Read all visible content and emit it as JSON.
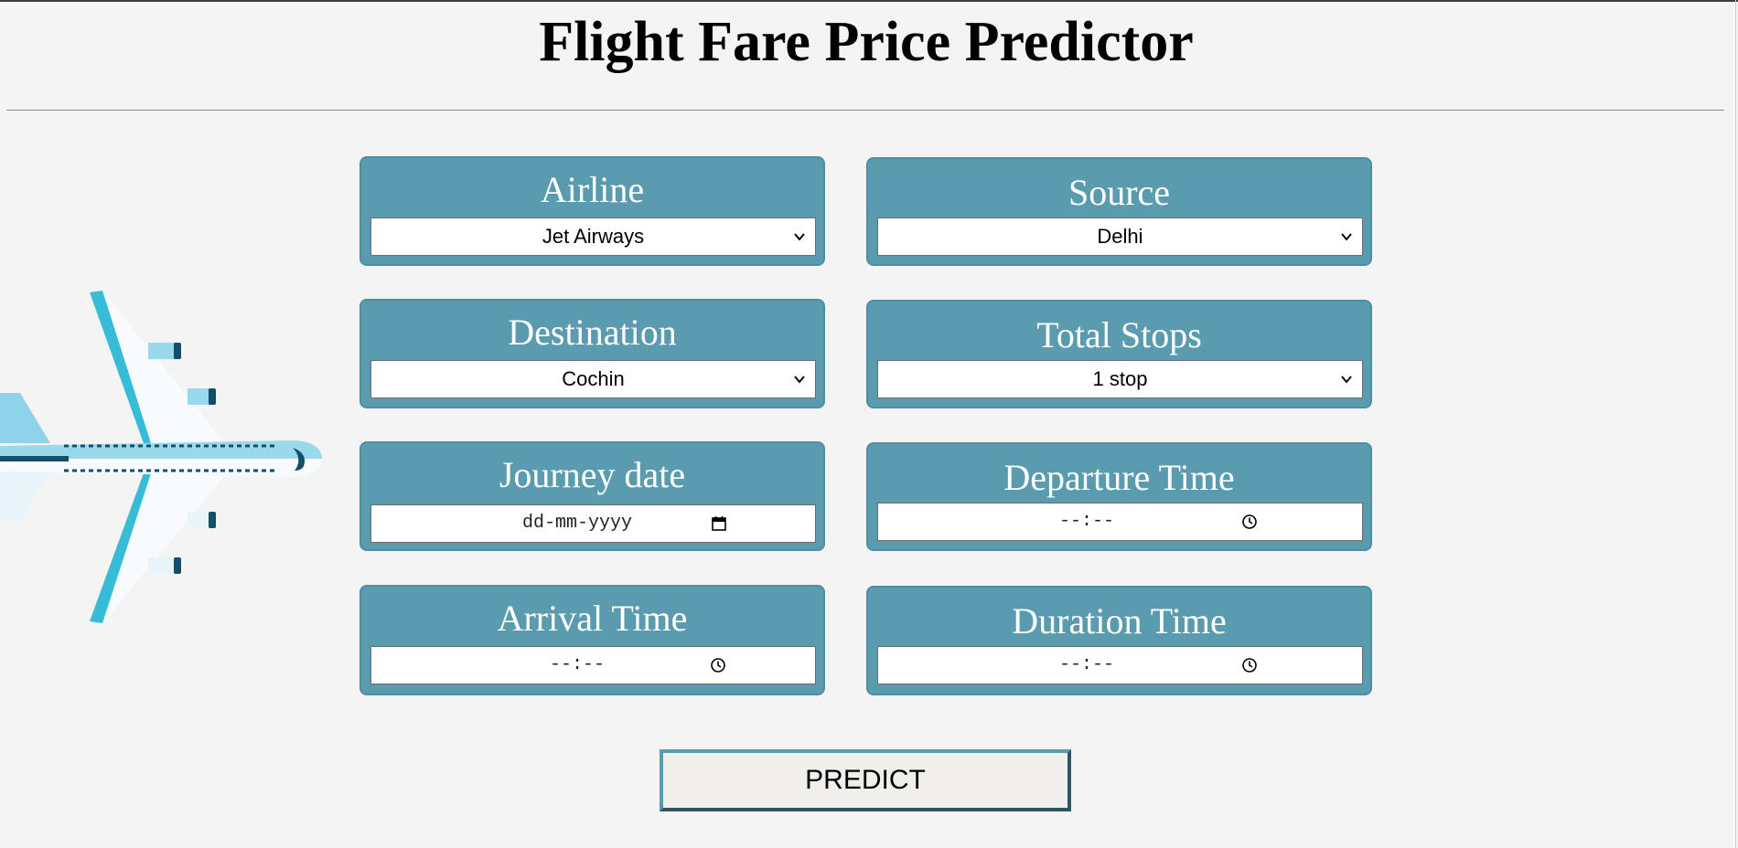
{
  "page": {
    "title": "Flight Fare Price Predictor"
  },
  "form": {
    "airline": {
      "label": "Airline",
      "value": "Jet Airways"
    },
    "source": {
      "label": "Source",
      "value": "Delhi"
    },
    "destination": {
      "label": "Destination",
      "value": "Cochin"
    },
    "total_stops": {
      "label": "Total Stops",
      "value": "1 stop"
    },
    "journey_date": {
      "label": "Journey date",
      "placeholder": "dd-mm-yyyy"
    },
    "departure_time": {
      "label": "Departure Time",
      "placeholder": "--:--"
    },
    "arrival_time": {
      "label": "Arrival Time",
      "placeholder": "--:--"
    },
    "duration_time": {
      "label": "Duration Time",
      "placeholder": "--:--"
    },
    "submit_label": "PREDICT"
  },
  "icons": {
    "plane": "airplane-illustration",
    "select": "chevron-down-icon",
    "date": "calendar-icon",
    "time": "clock-icon"
  },
  "colors": {
    "card_background": "#5a9baf",
    "page_background": "#f4f4f4",
    "button_border_dark": "#2d5563"
  }
}
